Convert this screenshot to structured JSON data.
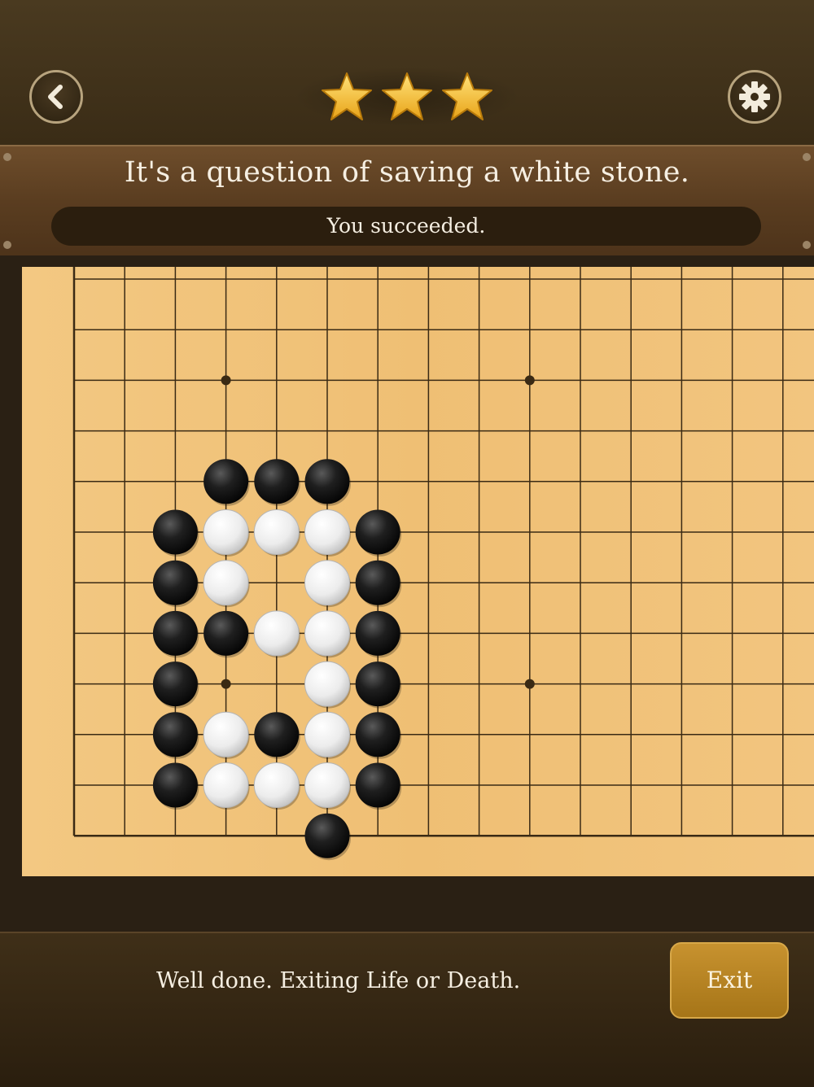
{
  "header": {
    "back_icon": "chevron-left-icon",
    "settings_icon": "gear-icon",
    "stars_earned": 3,
    "stars_total": 3
  },
  "puzzle": {
    "question": "It's a question of saving a white stone.",
    "status": "You succeeded."
  },
  "board": {
    "visible_columns": 15,
    "visible_rows": 12,
    "edges": [
      "left",
      "bottom"
    ],
    "star_points": [
      [
        3,
        2
      ],
      [
        9,
        2
      ],
      [
        3,
        8
      ],
      [
        9,
        8
      ]
    ],
    "black_stones": [
      [
        3,
        4
      ],
      [
        4,
        4
      ],
      [
        5,
        4
      ],
      [
        2,
        5
      ],
      [
        6,
        5
      ],
      [
        2,
        6
      ],
      [
        6,
        6
      ],
      [
        2,
        7
      ],
      [
        3,
        7
      ],
      [
        6,
        7
      ],
      [
        2,
        8
      ],
      [
        6,
        8
      ],
      [
        2,
        9
      ],
      [
        4,
        9
      ],
      [
        6,
        9
      ],
      [
        2,
        10
      ],
      [
        6,
        10
      ],
      [
        5,
        11
      ]
    ],
    "white_stones": [
      [
        3,
        5
      ],
      [
        4,
        5
      ],
      [
        5,
        5
      ],
      [
        3,
        6
      ],
      [
        5,
        6
      ],
      [
        4,
        7
      ],
      [
        5,
        7
      ],
      [
        5,
        8
      ],
      [
        3,
        9
      ],
      [
        5,
        9
      ],
      [
        3,
        10
      ],
      [
        4,
        10
      ],
      [
        5,
        10
      ]
    ],
    "colors": {
      "board": "#f0c27d",
      "line": "#3a2a14",
      "black": "#1a1a1a",
      "white": "#f4f4f4"
    }
  },
  "footer": {
    "message": "Well done. Exiting Life or Death.",
    "exit_label": "Exit"
  }
}
